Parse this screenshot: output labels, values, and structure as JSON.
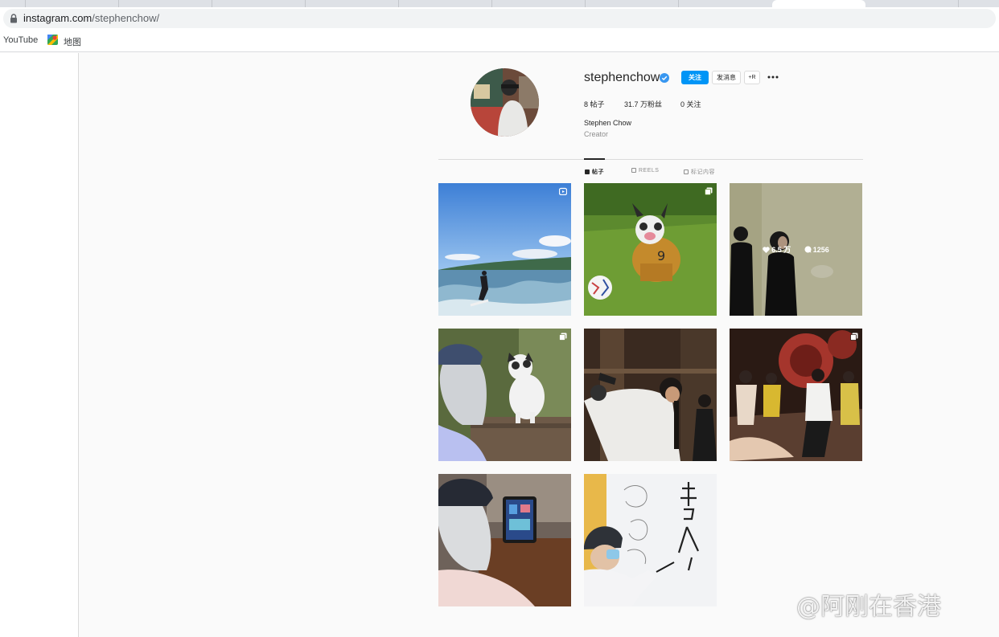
{
  "browser": {
    "url_host": "instagram.com",
    "url_path": "/stephenchow/",
    "bookmarks": [
      {
        "label": "YouTube"
      },
      {
        "label": "地图",
        "icon": "google-maps-icon"
      }
    ]
  },
  "profile": {
    "username": "stephenchow",
    "verified": true,
    "buttons": {
      "follow": "关注",
      "message": "发消息",
      "suggest": "+R"
    },
    "more_icon": "more-horizontal-icon",
    "stats": {
      "posts": "8 帖子",
      "followers_num": "31.7 万",
      "followers_label": "粉丝",
      "following": "0 关注"
    },
    "full_name": "Stephen Chow",
    "category": "Creator"
  },
  "tabs": [
    {
      "label": "帖子",
      "icon": "grid-icon",
      "active": true
    },
    {
      "label": "REELS",
      "icon": "reels-icon",
      "active": false
    },
    {
      "label": "标记内容",
      "icon": "tagged-icon",
      "active": false
    }
  ],
  "posts": [
    {
      "subject": "surfing",
      "badge": "reel-icon"
    },
    {
      "subject": "french-bulldog-on-grass",
      "badge": "carousel-icon"
    },
    {
      "subject": "couple-in-black",
      "hover": {
        "likes": "6.5 万",
        "comments": "1256"
      }
    },
    {
      "subject": "man-with-dog",
      "badge": "carousel-icon"
    },
    {
      "subject": "movie-scene-gun"
    },
    {
      "subject": "movie-scene-group",
      "badge": "carousel-icon"
    },
    {
      "subject": "man-with-tablet"
    },
    {
      "subject": "man-writing-whiteboard"
    }
  ],
  "watermark": "@阿刚在香港",
  "colors": {
    "accent": "#0095f6",
    "verified": "#3897f0"
  }
}
